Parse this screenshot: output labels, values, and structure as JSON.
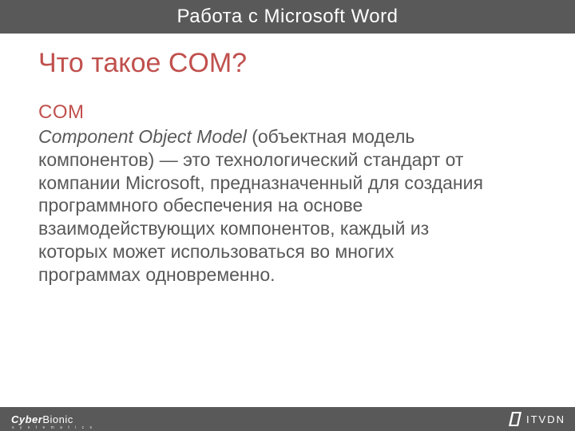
{
  "header": {
    "title": "Работа с Microsoft Word"
  },
  "slide": {
    "title": "Что такое COM?",
    "subhead": "COM",
    "body_em": "Component Object Model",
    "body_rest": " (объектная модель компонентов) — это технологический  стандарт от компании Microsoft, предназначенный для создания программного обеспечения на основе взаимодействующих компонентов, каждый из которых может использоваться во многих программах одновременно."
  },
  "footer": {
    "left_bold": "Cyber",
    "left_light": "Bionic",
    "left_sub": "s y s t e m a t i c s",
    "right": "ITVDN"
  }
}
